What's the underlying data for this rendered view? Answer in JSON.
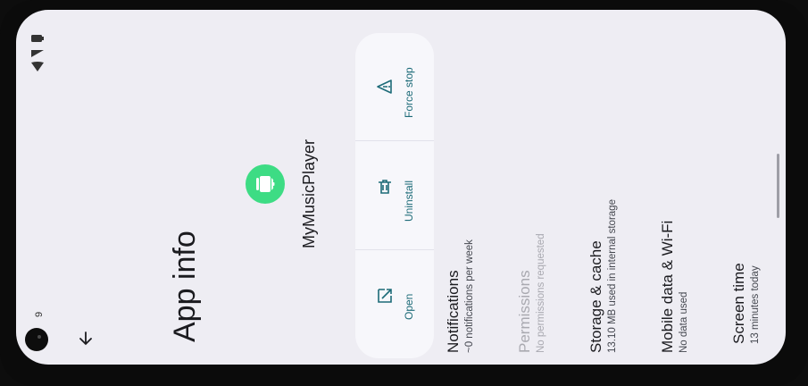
{
  "status_bar": {
    "time": "9",
    "battery_icon": "battery-icon",
    "wifi_icon": "wifi-icon",
    "signal_icon": "signal-icon"
  },
  "header": {
    "title": "App info",
    "back_icon": "back-arrow-icon"
  },
  "app": {
    "name": "MyMusicPlayer",
    "icon": "android-robot-icon",
    "icon_color": "#3ddc84"
  },
  "actions": [
    {
      "label": "Open",
      "icon": "open-external-icon"
    },
    {
      "label": "Uninstall",
      "icon": "trash-icon"
    },
    {
      "label": "Force stop",
      "icon": "warning-icon"
    }
  ],
  "settings": [
    {
      "title": "Notifications",
      "subtitle": "~0 notifications per week",
      "enabled": true
    },
    {
      "title": "Permissions",
      "subtitle": "No permissions requested",
      "enabled": false
    },
    {
      "title": "Storage & cache",
      "subtitle": "13.10 MB used in internal storage",
      "enabled": true
    },
    {
      "title": "Mobile data & Wi-Fi",
      "subtitle": "No data used",
      "enabled": true
    },
    {
      "title": "Screen time",
      "subtitle": "13 minutes today",
      "enabled": true
    }
  ],
  "accent_color": "#1d6b78"
}
